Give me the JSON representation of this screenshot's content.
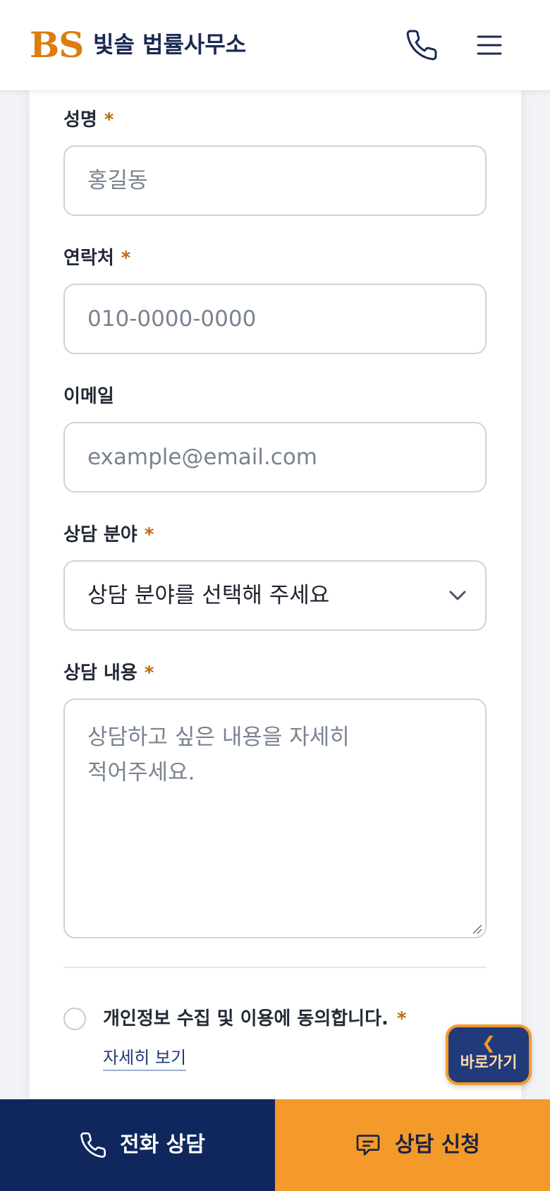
{
  "header": {
    "logo": "BS",
    "brand_name": "빛솔 법률사무소",
    "phone_icon": "phone-icon",
    "menu_icon": "hamburger-menu-icon"
  },
  "form": {
    "name": {
      "label": "성명",
      "required_mark": "*",
      "placeholder": "홍길동"
    },
    "phone": {
      "label": "연락처",
      "required_mark": "*",
      "placeholder": "010-0000-0000"
    },
    "email": {
      "label": "이메일",
      "placeholder": "example@email.com"
    },
    "category": {
      "label": "상담 분야",
      "required_mark": "*",
      "selected": "상담 분야를 선택해 주세요"
    },
    "content": {
      "label": "상담 내용",
      "required_mark": "*",
      "placeholder": "상담하고 싶은 내용을 자세히\n적어주세요."
    },
    "consent": {
      "label": "개인정보 수집 및 이용에 동의합니다.",
      "required_mark": "*",
      "detail_link": "자세히 보기"
    }
  },
  "quick_button": {
    "label": "바로가기",
    "icon": "chevron-left-icon"
  },
  "bottom_bar": {
    "call_label": "전화 상담",
    "apply_label": "상담 신청"
  },
  "colors": {
    "brand_orange": "#dc7d12",
    "navy": "#10275e",
    "accent_orange": "#f39a2a"
  }
}
